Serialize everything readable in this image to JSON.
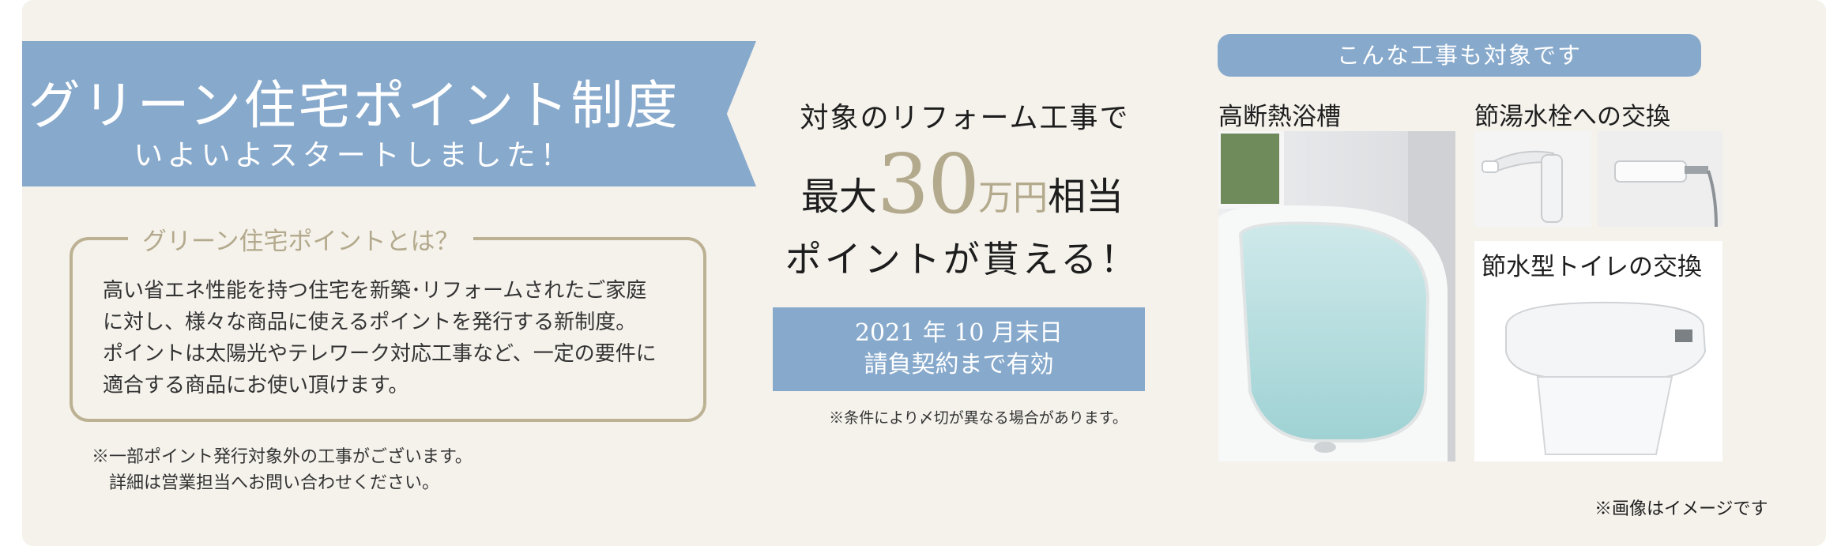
{
  "ribbon": {
    "title": "グリーン住宅ポイント制度",
    "subtitle": "いよいよスタートしました！"
  },
  "info": {
    "title": "グリーン住宅ポイントとは？",
    "lines": [
      "高い省エネ性能を持つ住宅を新築･リフォームされたご家庭",
      "に対し、様々な商品に使えるポイントを発行する新制度。",
      "ポイントは太陽光やテレワーク対応工事など、一定の要件に",
      "適合する商品にお使い頂けます。"
    ]
  },
  "bottom_note": {
    "lines": [
      "※一部ポイント発行対象外の工事がございます。",
      "　詳細は営業担当へお問い合わせください。"
    ]
  },
  "center": {
    "line1": "対象のリフォーム工事で",
    "max_prefix": "最大",
    "amount": "30",
    "unit": "万円",
    "suffix": "相当",
    "line3": "ポイントが貰える！",
    "valid_line1": "2021 年 10 月末日",
    "valid_line2": "請負契約まで有効",
    "note": "※条件により〆切が異なる場合があります。"
  },
  "right": {
    "pill": "こんな工事も対象です",
    "bath_label": "高断熱浴槽",
    "faucet_label": "節湯水栓への交換",
    "toilet_label": "節水型トイレの交換",
    "image_note": "※画像はイメージです"
  }
}
